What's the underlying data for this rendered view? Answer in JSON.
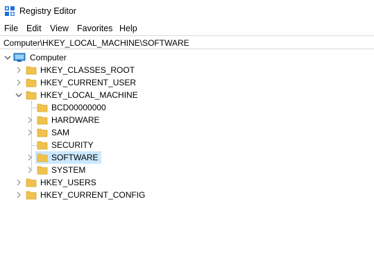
{
  "window": {
    "title": "Registry Editor"
  },
  "menu": {
    "file": "File",
    "edit": "Edit",
    "view": "View",
    "favorites": "Favorites",
    "help": "Help"
  },
  "address": {
    "path": "Computer\\HKEY_LOCAL_MACHINE\\SOFTWARE"
  },
  "tree": {
    "root": "Computer",
    "hives": {
      "classes_root": "HKEY_CLASSES_ROOT",
      "current_user": "HKEY_CURRENT_USER",
      "local_machine": "HKEY_LOCAL_MACHINE",
      "users": "HKEY_USERS",
      "current_config": "HKEY_CURRENT_CONFIG"
    },
    "local_machine_children": {
      "bcd": "BCD00000000",
      "hardware": "HARDWARE",
      "sam": "SAM",
      "security": "SECURITY",
      "software": "SOFTWARE",
      "system": "SYSTEM"
    },
    "selected": "SOFTWARE"
  },
  "colors": {
    "selection": "#cce8ff",
    "folder": "#f0c24d",
    "icon_blue": "#1e6fd9"
  }
}
